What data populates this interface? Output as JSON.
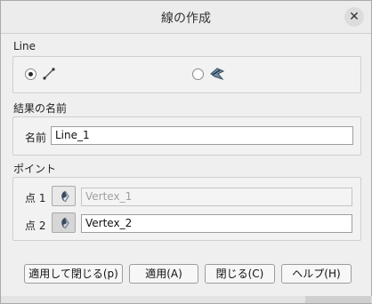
{
  "dialog": {
    "title": "線の作成",
    "close_glyph": "✕"
  },
  "line_section": {
    "label": "Line",
    "option1_icon": "line-segment-icon",
    "option2_icon": "edge-on-face-icon",
    "selected_option": 1
  },
  "result_section": {
    "label": "結果の名前",
    "name_label": "名前",
    "name_value": "Line_1"
  },
  "points_section": {
    "label": "ポイント",
    "point1_label": "点 1",
    "point1_value": "Vertex_1",
    "point2_label": "点 2",
    "point2_value": "Vertex_2",
    "select_icon": "select-arrow-icon"
  },
  "buttons": {
    "apply_close": "適用して閉じる(p)",
    "apply": "適用(A)",
    "close": "閉じる(C)",
    "help": "ヘルプ(H)"
  }
}
